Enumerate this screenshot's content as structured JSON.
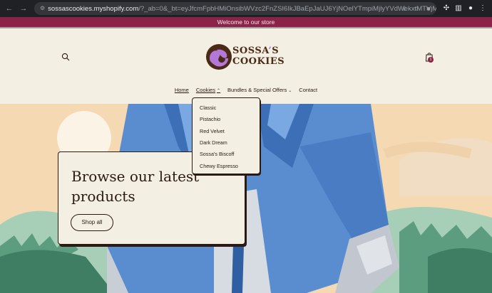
{
  "browser": {
    "url_host": "sossascookies.myshopify.com",
    "url_rest": "/?_ab=0&_bt=eyJfcmFpbHMiOnsibWVzc2FnZSI6IkJBaEpJaUJ6YjNOelYTmpiMjlyYVdWekxtMTVjMmh2Y0dsbWVTNWpiMjBHT2daRlZ..."
  },
  "announcement": "Welcome to our store",
  "logo": {
    "line1": "SOSSA",
    "apostrophe": "’",
    "line1_end": "S",
    "line2": "COOKIES",
    "colors": {
      "brown": "#4a2a17",
      "purple": "#b478d8"
    }
  },
  "cart": {
    "count": "1"
  },
  "nav": {
    "items": [
      {
        "label": "Home",
        "active": true
      },
      {
        "label": "Cookies",
        "active": false,
        "has_dropdown": true
      },
      {
        "label": "Bundles & Special Offers",
        "active": false,
        "has_dropdown": true
      },
      {
        "label": "Contact",
        "active": false
      }
    ]
  },
  "dropdown": {
    "items": [
      "Classic",
      "Pistachio",
      "Red Velvet",
      "Dark Dream",
      "Sossa's Biscoff",
      "Chewy Espresso"
    ]
  },
  "hero": {
    "title": "Browse our latest products",
    "button": "Shop all"
  },
  "colors": {
    "announcement_bg": "#8a2347",
    "background": "#f3efe3",
    "text": "#2b1a12"
  }
}
